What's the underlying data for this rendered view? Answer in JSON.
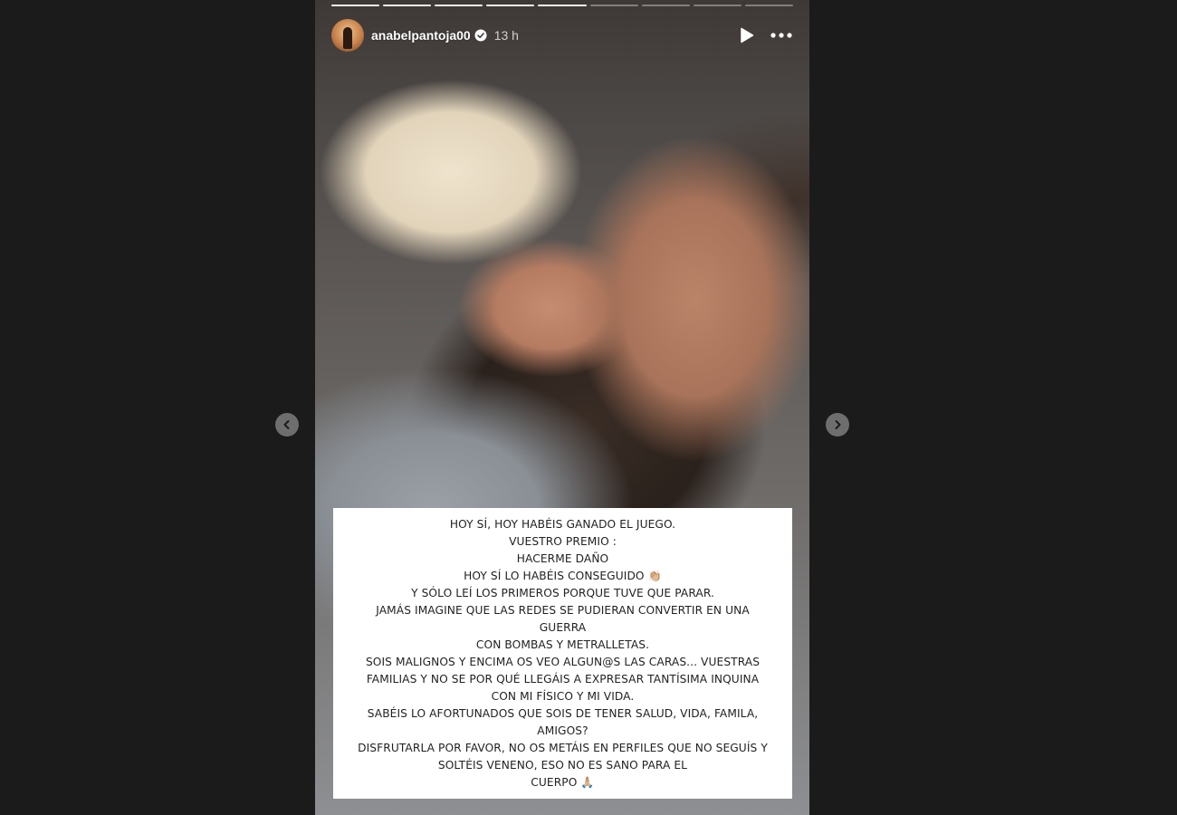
{
  "story": {
    "progress": {
      "total": 9,
      "completed": 5
    },
    "author": {
      "username": "anabelpantoja00",
      "verified": true,
      "time": "13 h"
    },
    "controls": {
      "play_icon": "play-icon",
      "more_icon": "more-horizontal-icon"
    },
    "text_lines": [
      "HOY SÍ, HOY HABÉIS GANADO EL JUEGO.",
      "VUESTRO PREMIO :",
      "HACERME DAÑO",
      "HOY SÍ LO HABÉIS CONSEGUIDO 👏🏼",
      "Y SÓLO LEÍ LOS PRIMEROS PORQUE TUVE QUE PARAR.",
      "JAMÁS IMAGINE QUE LAS REDES SE PUDIERAN CONVERTIR EN UNA GUERRA",
      "CON BOMBAS Y METRALLETAS.",
      "SOIS MALIGNOS Y ENCIMA OS VEO ALGUN@S LAS CARAS... VUESTRAS",
      "FAMILIAS Y NO SE POR QUÉ LLEGÁIS A EXPRESAR TANTÍSIMA INQUINA",
      "CON MI FÍSICO Y MI VIDA.",
      "SABÉIS LO AFORTUNADOS QUE SOIS DE TENER SALUD, VIDA, FAMILA,",
      "AMIGOS?",
      "DISFRUTARLA POR FAVOR, NO OS METÁIS EN PERFILES QUE NO SEGUÍS Y",
      "SOLTÉIS VENENO, ESO NO ES SANO PARA EL",
      "CUERPO 🙏🏼"
    ]
  },
  "navigation": {
    "prev_icon": "chevron-left-icon",
    "next_icon": "chevron-right-icon"
  },
  "colors": {
    "background": "#1b1b1b",
    "verified_badge": "#ffffff",
    "text": "#222222"
  }
}
